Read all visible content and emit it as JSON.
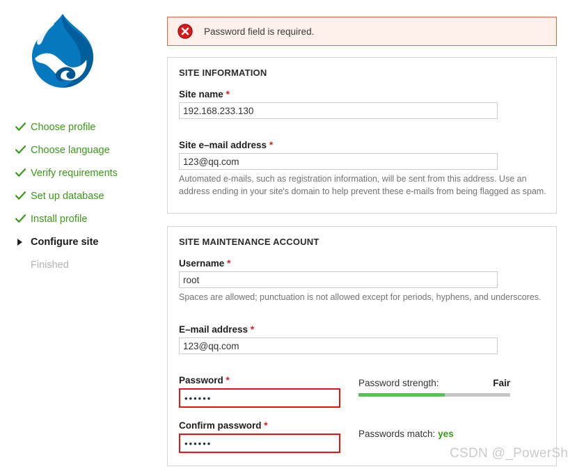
{
  "logo": {
    "name": "drupal-droplet-logo",
    "colors": {
      "light": "#0678be",
      "dark": "#00568f",
      "highlight": "#ffffff"
    }
  },
  "sidebar": {
    "items": [
      {
        "label": "Choose profile",
        "state": "done",
        "icon": "check-icon"
      },
      {
        "label": "Choose language",
        "state": "done",
        "icon": "check-icon"
      },
      {
        "label": "Verify requirements",
        "state": "done",
        "icon": "check-icon"
      },
      {
        "label": "Set up database",
        "state": "done",
        "icon": "check-icon"
      },
      {
        "label": "Install profile",
        "state": "done",
        "icon": "check-icon"
      },
      {
        "label": "Configure site",
        "state": "active",
        "icon": "triangle-right-icon"
      },
      {
        "label": "Finished",
        "state": "todo",
        "icon": "none"
      }
    ]
  },
  "error": {
    "icon": "error-x-icon",
    "message": "Password field is required.",
    "border_color": "#e8623a",
    "background_color": "#fdf0ea"
  },
  "site_information": {
    "title": "SITE INFORMATION",
    "site_name": {
      "label": "Site name",
      "required_marker": "*",
      "value": "192.168.233.130",
      "placeholder": ""
    },
    "site_email": {
      "label": "Site e–mail address",
      "required_marker": "*",
      "value": "123@qq.com",
      "placeholder": "",
      "description": "Automated e-mails, such as registration information, will be sent from this address. Use an address ending in your site's domain to help prevent these e-mails from being flagged as spam."
    }
  },
  "site_maintenance_account": {
    "title": "SITE MAINTENANCE ACCOUNT",
    "username": {
      "label": "Username",
      "required_marker": "*",
      "value": "root",
      "placeholder": "",
      "description": "Spaces are allowed; punctuation is not allowed except for periods, hyphens, and underscores."
    },
    "email": {
      "label": "E–mail address",
      "required_marker": "*",
      "value": "123@qq.com",
      "placeholder": ""
    },
    "password": {
      "label": "Password",
      "required_marker": "*",
      "value": "••••••",
      "placeholder": "",
      "strength_label": "Password strength:",
      "strength_value": "Fair",
      "strength_percent": 57,
      "strength_color": "#57c253",
      "error_border_color": "#ee1111"
    },
    "confirm_password": {
      "label": "Confirm password",
      "required_marker": "*",
      "value": "••••••",
      "placeholder": "",
      "match_label": "Passwords match:",
      "match_value": "yes",
      "error_border_color": "#ee1111"
    }
  },
  "watermark": {
    "text": "CSDN @_PowerShell"
  }
}
